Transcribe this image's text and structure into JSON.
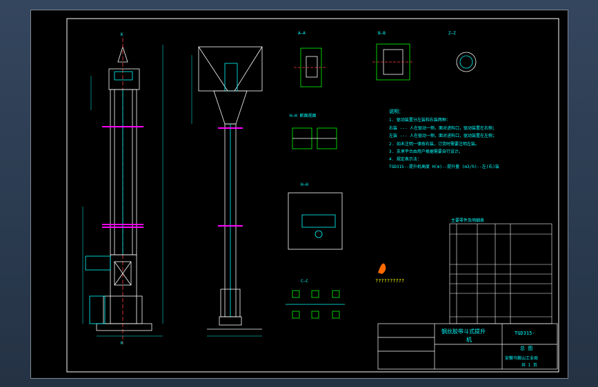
{
  "drawing": {
    "notes_title": "说明：",
    "notes": [
      "1. 驱动装置分左装和右装两种：",
      "   右装 --- 人在驱动一侧，面对进料口，驱动装置在右侧；",
      "   左装 --- 人在驱动一侧，面对进料口，驱动装置在左侧；",
      "2. 如未注明一律按右装，订货时需要注明左装。",
      "3. 支承平台由用户根据需要自行设计。",
      "4. 规定表示法：",
      "   TGD315--提升机高度 H(m)--提升量 (m3/h)--左(右)装"
    ],
    "section_labels": [
      "A—A",
      "B—B",
      "Z—Z",
      "H—H",
      "H—H 断面视图",
      "C—C"
    ],
    "watermark": "??????????",
    "title_block": {
      "name_line1": "钢丝胶带斗式提升",
      "name_line2": "机",
      "drawing_no": "TGD315-",
      "view": "总 图",
      "company": "安徽马鞍山工业局",
      "sheet": "共 1 页"
    },
    "parts_table_title": "主要零件及明细表"
  },
  "colors": {
    "background": "#000000",
    "line": "#ffffff",
    "dim": "#00ffff",
    "accent": "#ff00ff",
    "text": "#ffff00",
    "green": "#00ff00"
  }
}
